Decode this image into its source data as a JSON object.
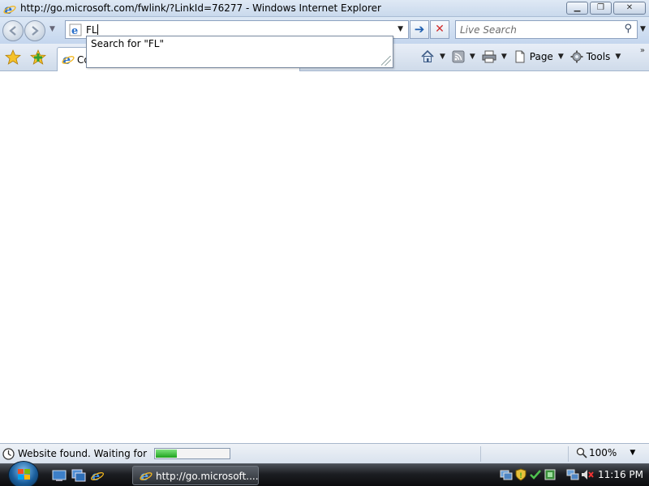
{
  "window": {
    "title": "http://go.microsoft.com/fwlink/?LinkId=76277 - Windows Internet Explorer",
    "controls": {
      "minimize": "minimize",
      "maximize": "restore",
      "close": "close"
    }
  },
  "address_bar": {
    "value": "FL",
    "go_icon": "arrow-right-icon",
    "stop_icon": "red-x-icon"
  },
  "search_box": {
    "placeholder": "Live Search"
  },
  "autocomplete": {
    "items": [
      "Search for \"FL\""
    ]
  },
  "tab": {
    "label": "Co"
  },
  "command_bar": {
    "page_label": "Page",
    "tools_label": "Tools"
  },
  "status_bar": {
    "text": "Website found. Waiting for rep",
    "progress_percent": 30,
    "zoom": "100%"
  },
  "taskbar": {
    "task_label": "http://go.microsoft....",
    "clock": "11:16 PM"
  },
  "colors": {
    "progress_fill": "#1ea21e",
    "stop_red": "#d02b2b",
    "go_blue": "#1f5fb0"
  }
}
